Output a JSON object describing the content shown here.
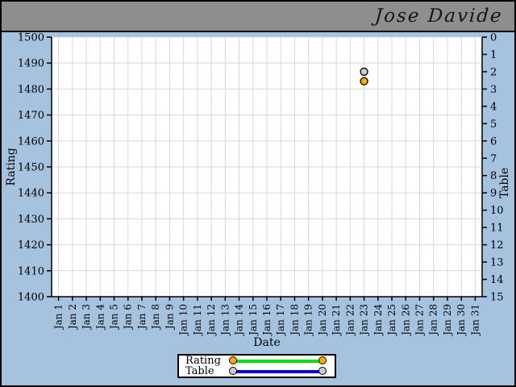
{
  "window": {
    "title": "Jose Davide"
  },
  "colors": {
    "header_bg": "#8e8e8e",
    "chart_bg": "#a5c2de",
    "plot_bg": "#ffffff",
    "grid": "#d8d8d8",
    "axis": "#000000"
  },
  "chart_data": {
    "type": "line",
    "title": "Jose Davide",
    "xlabel": "Date",
    "categories": [
      "Jan 1",
      "Jan 2",
      "Jan 3",
      "Jan 4",
      "Jan 5",
      "Jan 6",
      "Jan 7",
      "Jan 8",
      "Jan 9",
      "Jan 10",
      "Jan 11",
      "Jan 12",
      "Jan 13",
      "Jan 14",
      "Jan 15",
      "Jan 16",
      "Jan 17",
      "Jan 18",
      "Jan 19",
      "Jan 20",
      "Jan 21",
      "Jan 22",
      "Jan 23",
      "Jan 24",
      "Jan 25",
      "Jan 26",
      "Jan 27",
      "Jan 28",
      "Jan 29",
      "Jan 30",
      "Jan 31"
    ],
    "left_axis": {
      "label": "Rating",
      "min": 1400,
      "max": 1500,
      "step": 10,
      "inverted": false
    },
    "right_axis": {
      "label": "Table",
      "min": 0,
      "max": 15,
      "step": 1,
      "inverted": true
    },
    "grid": true,
    "legend_position": "bottom",
    "series": [
      {
        "name": "Rating",
        "axis": "left",
        "line_color": "#00e100",
        "marker_fill": "#ffaa00",
        "marker_stroke": "#000000",
        "points": [
          {
            "category": "Jan 23",
            "value": 1483
          }
        ]
      },
      {
        "name": "Table",
        "axis": "right",
        "line_color": "#0000dd",
        "marker_fill": "#cccccc",
        "marker_stroke": "#000000",
        "points": [
          {
            "category": "Jan 23",
            "value": 2
          }
        ]
      }
    ]
  }
}
